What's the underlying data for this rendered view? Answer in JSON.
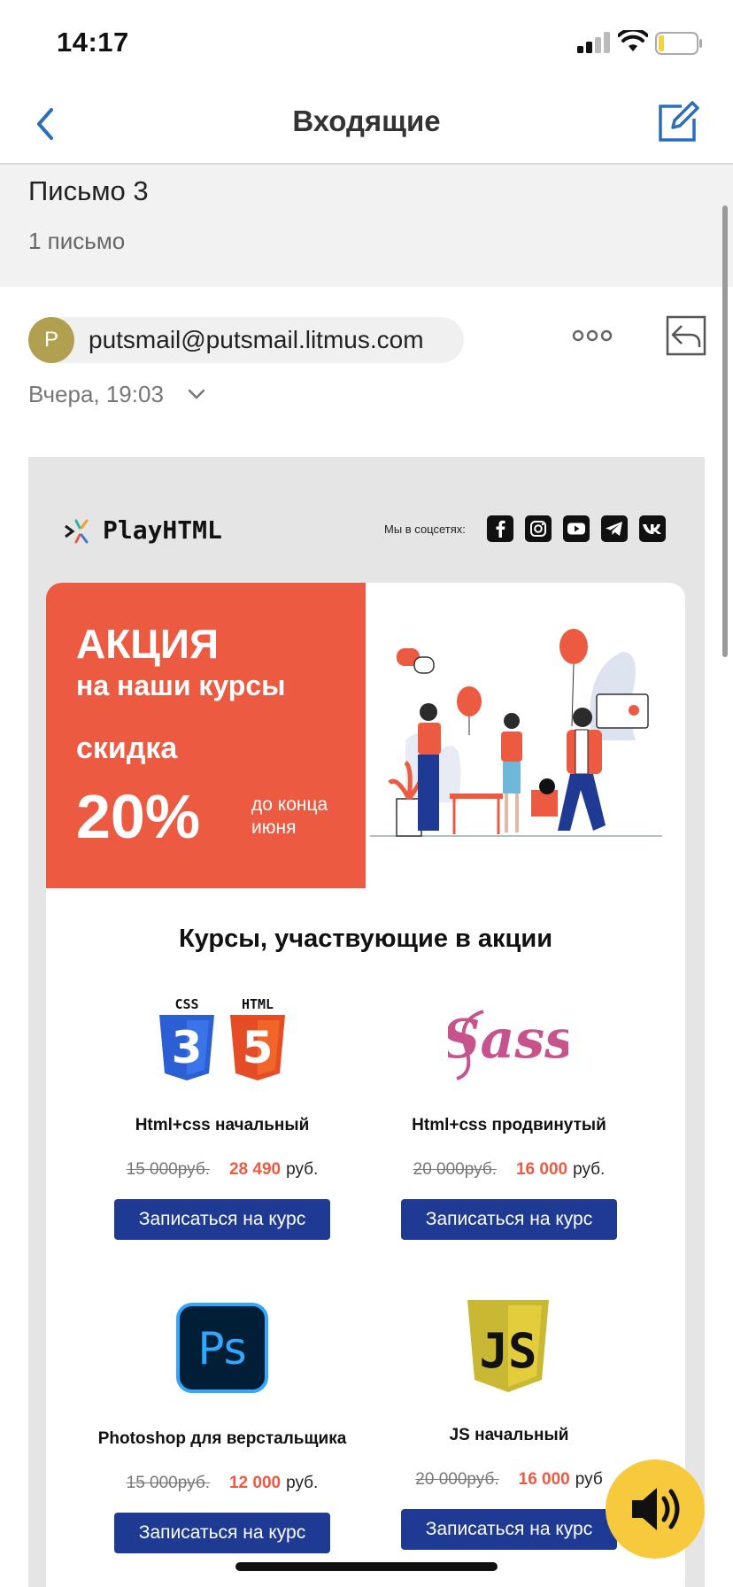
{
  "status_bar": {
    "time": "14:17"
  },
  "nav": {
    "title": "Входящие"
  },
  "thread": {
    "title": "Письмо 3",
    "count": "1 письмо"
  },
  "message": {
    "avatar_letter": "P",
    "sender": "putsmail@putsmail.litmus.com",
    "date": "Вчера, 19:03"
  },
  "email": {
    "brand": "PlayHTML",
    "social_label": "Мы в соцсетях:",
    "social_icons": [
      "facebook-icon",
      "instagram-icon",
      "youtube-icon",
      "telegram-icon",
      "vk-icon"
    ],
    "promo": {
      "line1": "АКЦИЯ",
      "line2": "на наши курсы",
      "line3": "скидка",
      "discount": "20%",
      "until": "до конца июня"
    },
    "section_title": "Курсы, участвующие в акции",
    "courses": [
      {
        "name": "Html+css начальный",
        "old_price": "15 000руб.",
        "new_price": "28 490",
        "currency": "руб.",
        "button": "Записаться на курс",
        "icon": "css-html-icon"
      },
      {
        "name": "Html+css продвинутый",
        "old_price": "20 000руб.",
        "new_price": "16 000",
        "currency": "руб.",
        "button": "Записаться на курс",
        "icon": "sass-icon"
      },
      {
        "name": "Photoshop для верстальщика",
        "old_price": "15 000руб.",
        "new_price": "12 000",
        "currency": "руб.",
        "button": "Записаться на курс",
        "icon": "photoshop-icon"
      },
      {
        "name": "JS начальный",
        "old_price": "20 000руб.",
        "new_price": "16 000",
        "currency": "руб",
        "button": "Записаться на курс",
        "icon": "js-icon"
      }
    ],
    "logo_labels": {
      "css": "CSS",
      "html": "HTML",
      "ps": "Ps",
      "js": "JS"
    }
  },
  "colors": {
    "accent": "#ec5a42",
    "button": "#1f3a93",
    "link": "#2a6ebb",
    "audio": "#f7c93c"
  }
}
